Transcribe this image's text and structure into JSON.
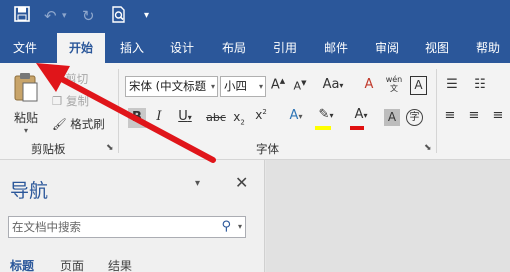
{
  "quick_access": {
    "save_icon": "save-icon",
    "undo_icon": "undo-icon",
    "redo_icon": "redo-icon",
    "print_preview_icon": "print-preview-icon",
    "customize_icon": "customize-qat-icon"
  },
  "tabs": [
    {
      "label": "文件",
      "active": false
    },
    {
      "label": "开始",
      "active": true
    },
    {
      "label": "插入",
      "active": false
    },
    {
      "label": "设计",
      "active": false
    },
    {
      "label": "布局",
      "active": false
    },
    {
      "label": "引用",
      "active": false
    },
    {
      "label": "邮件",
      "active": false
    },
    {
      "label": "审阅",
      "active": false
    },
    {
      "label": "视图",
      "active": false
    },
    {
      "label": "帮助",
      "active": false
    }
  ],
  "clipboard": {
    "paste_label": "粘贴",
    "cut_label": "剪切",
    "copy_label": "复制",
    "format_painter_label": "格式刷",
    "group_label": "剪贴板"
  },
  "font": {
    "font_name": "宋体 (中文标题",
    "font_size": "小四",
    "group_label": "字体",
    "phonetic_label": "wén\n文"
  },
  "navigation": {
    "title": "导航",
    "search_placeholder": "在文档中搜索",
    "tabs": [
      {
        "label": "标题",
        "active": true
      },
      {
        "label": "页面",
        "active": false
      },
      {
        "label": "结果",
        "active": false
      }
    ]
  },
  "colors": {
    "ribbon_blue": "#2b579a",
    "arrow_red": "#e0151a",
    "highlight_yellow": "#ffff00",
    "font_color_red": "#e01010"
  }
}
